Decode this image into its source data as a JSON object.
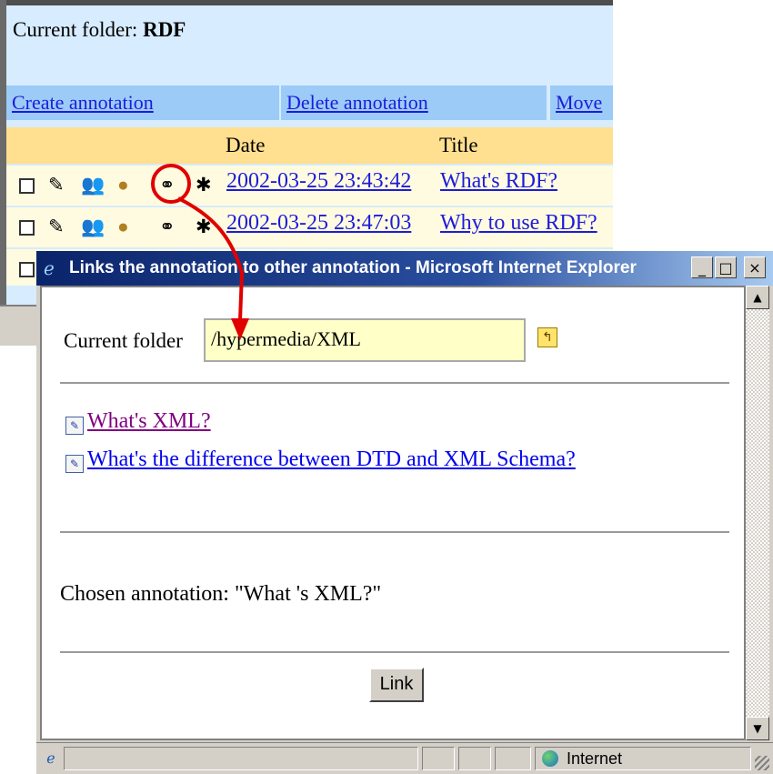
{
  "background_page": {
    "current_folder_prefix": "Current folder:",
    "current_folder_name": "RDF",
    "actions": [
      "Create annotation",
      "Delete annotation",
      "Move"
    ],
    "table": {
      "headers": [
        "Date",
        "Title"
      ],
      "rows": [
        {
          "date": "2002-03-25 23:43:42",
          "title": "What's RDF?"
        },
        {
          "date": "2002-03-25 23:47:03",
          "title": "Why to use RDF?"
        }
      ]
    }
  },
  "popup": {
    "title": "Links the annotation to other annotation - Microsoft Internet Explorer",
    "window_buttons": {
      "minimize": "_",
      "maximize": "□",
      "close": "×"
    },
    "folder_label": "Current folder",
    "folder_value": "/hypermedia/XML",
    "annotations": [
      {
        "label": "What's XML?",
        "color": "#800080"
      },
      {
        "label": "What's the difference between DTD and XML Schema?",
        "color": "#0000ee"
      }
    ],
    "chosen_text": "Chosen annotation: \"What 's XML?\"",
    "link_button": "Link",
    "status": {
      "zone": "Internet"
    }
  },
  "colors": {
    "annotation_red": "#e00000",
    "link_blue": "#1c1cdc",
    "visited_purple": "#800080"
  }
}
